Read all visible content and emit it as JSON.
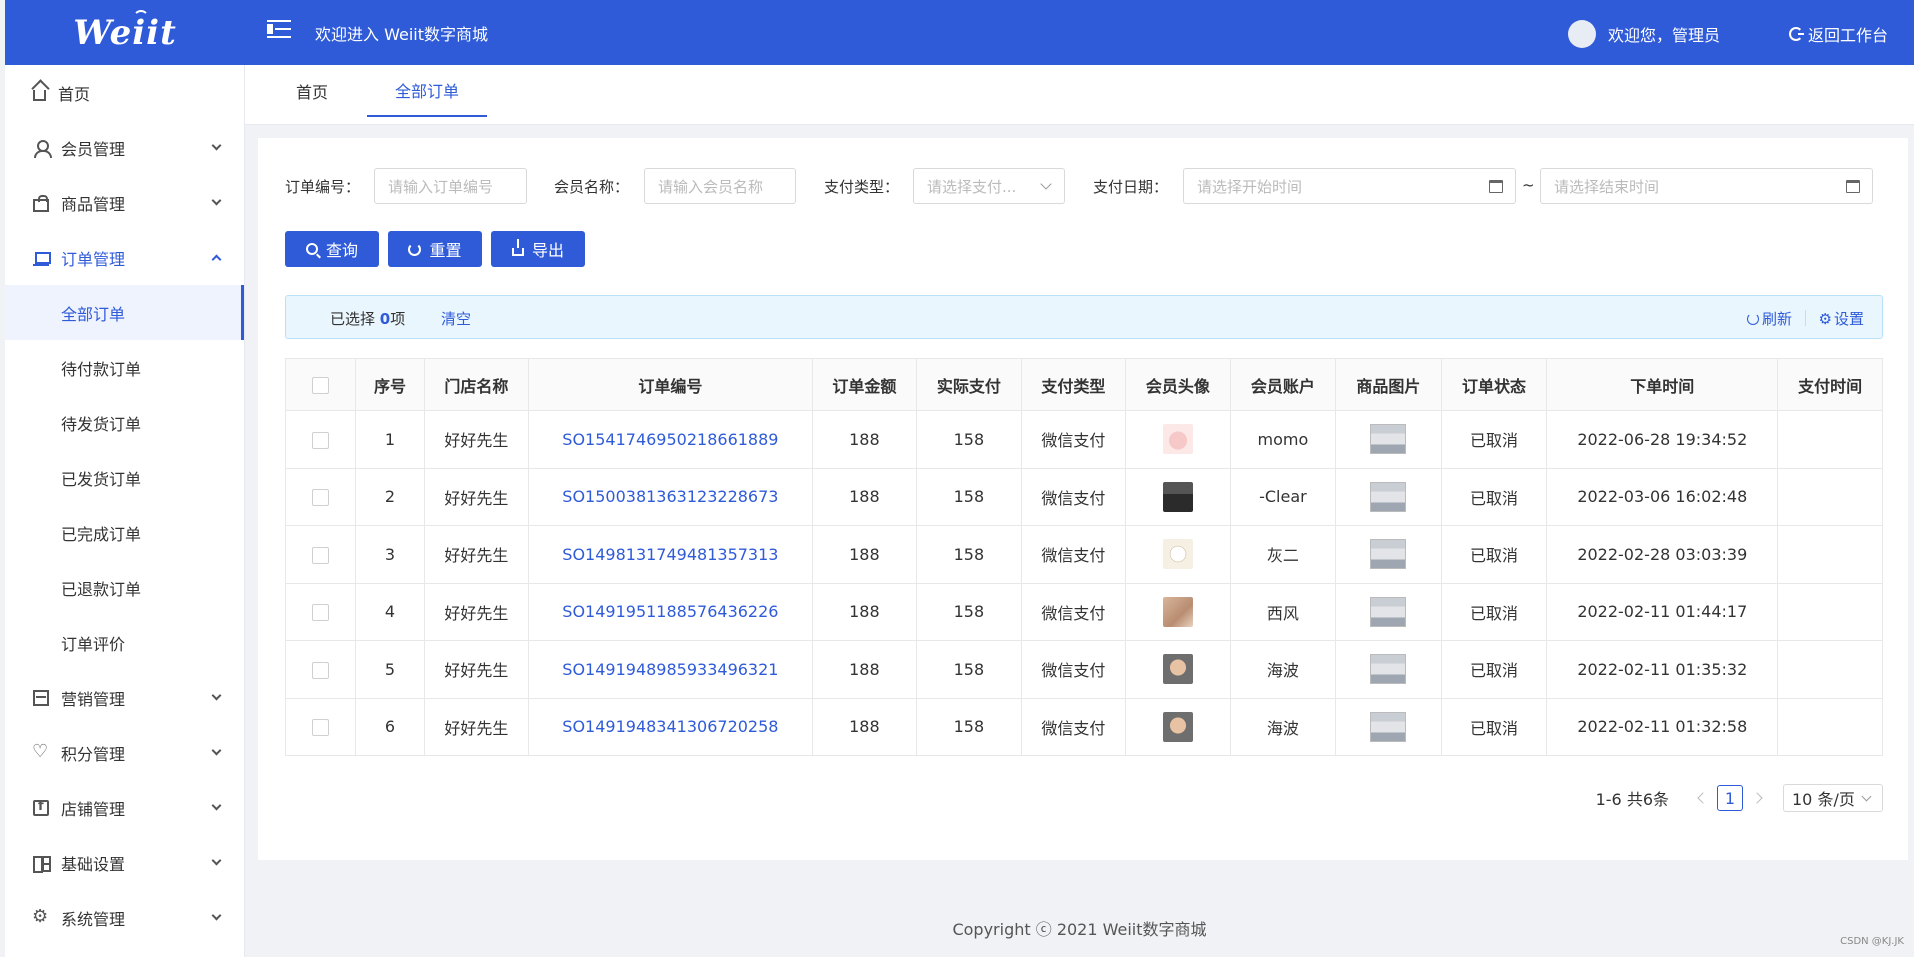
{
  "header": {
    "logo": "Weiit",
    "welcome": "欢迎进入 Weiit数字商城",
    "user": "欢迎您，管理员",
    "back": "返回工作台"
  },
  "sidebar": {
    "items": [
      {
        "label": "首页",
        "icon": "home-icon"
      },
      {
        "label": "会员管理",
        "icon": "user-icon"
      },
      {
        "label": "商品管理",
        "icon": "bag-icon"
      },
      {
        "label": "订单管理",
        "icon": "cart-icon"
      },
      {
        "label": "营销管理",
        "icon": "shop-icon"
      },
      {
        "label": "积分管理",
        "icon": "heart-icon"
      },
      {
        "label": "店铺管理",
        "icon": "facebook-icon"
      },
      {
        "label": "基础设置",
        "icon": "grid-icon"
      },
      {
        "label": "系统管理",
        "icon": "gear-icon"
      }
    ],
    "order_sub": [
      "全部订单",
      "待付款订单",
      "待发货订单",
      "已发货订单",
      "已完成订单",
      "已退款订单",
      "订单评价"
    ]
  },
  "tabs": [
    "首页",
    "全部订单"
  ],
  "filters": {
    "order_no_label": "订单编号：",
    "order_no_placeholder": "请输入订单编号",
    "member_label": "会员名称：",
    "member_placeholder": "请输入会员名称",
    "pay_type_label": "支付类型：",
    "pay_type_placeholder": "请选择支付...",
    "pay_date_label": "支付日期：",
    "start_placeholder": "请选择开始时间",
    "tilde": "~",
    "end_placeholder": "请选择结束时间"
  },
  "buttons": {
    "query": "查询",
    "reset": "重置",
    "export": "导出"
  },
  "alert": {
    "selected_prefix": "已选择 ",
    "selected_count": "0",
    "selected_suffix": "项",
    "clear": "清空",
    "refresh": "刷新",
    "settings": "设置"
  },
  "table": {
    "headers": [
      "序号",
      "门店名称",
      "订单编号",
      "订单金额",
      "实际支付",
      "支付类型",
      "会员头像",
      "会员账户",
      "商品图片",
      "订单状态",
      "下单时间",
      "支付时间"
    ],
    "rows": [
      {
        "no": "1",
        "store": "好好先生",
        "order": "SO1541746950218661889",
        "amount": "188",
        "paid": "158",
        "pay_type": "微信支付",
        "account": "momo",
        "status": "已取消",
        "created": "2022-06-28 19:34:52",
        "pay_time": ""
      },
      {
        "no": "2",
        "store": "好好先生",
        "order": "SO1500381363123228673",
        "amount": "188",
        "paid": "158",
        "pay_type": "微信支付",
        "account": "-Clear",
        "status": "已取消",
        "created": "2022-03-06 16:02:48",
        "pay_time": ""
      },
      {
        "no": "3",
        "store": "好好先生",
        "order": "SO1498131749481357313",
        "amount": "188",
        "paid": "158",
        "pay_type": "微信支付",
        "account": "灰二",
        "status": "已取消",
        "created": "2022-02-28 03:03:39",
        "pay_time": ""
      },
      {
        "no": "4",
        "store": "好好先生",
        "order": "SO1491951188576436226",
        "amount": "188",
        "paid": "158",
        "pay_type": "微信支付",
        "account": "西风",
        "status": "已取消",
        "created": "2022-02-11 01:44:17",
        "pay_time": ""
      },
      {
        "no": "5",
        "store": "好好先生",
        "order": "SO1491948985933496321",
        "amount": "188",
        "paid": "158",
        "pay_type": "微信支付",
        "account": "海波",
        "status": "已取消",
        "created": "2022-02-11 01:35:32",
        "pay_time": ""
      },
      {
        "no": "6",
        "store": "好好先生",
        "order": "SO1491948341306720258",
        "amount": "188",
        "paid": "158",
        "pay_type": "微信支付",
        "account": "海波",
        "status": "已取消",
        "created": "2022-02-11 01:32:58",
        "pay_time": ""
      }
    ]
  },
  "pagination": {
    "total": "1-6 共6条",
    "page": "1",
    "size": "10 条/页"
  },
  "footer": "Copyright ⓒ 2021 Weiit数字商城",
  "watermark": "CSDN @KJ.JK"
}
